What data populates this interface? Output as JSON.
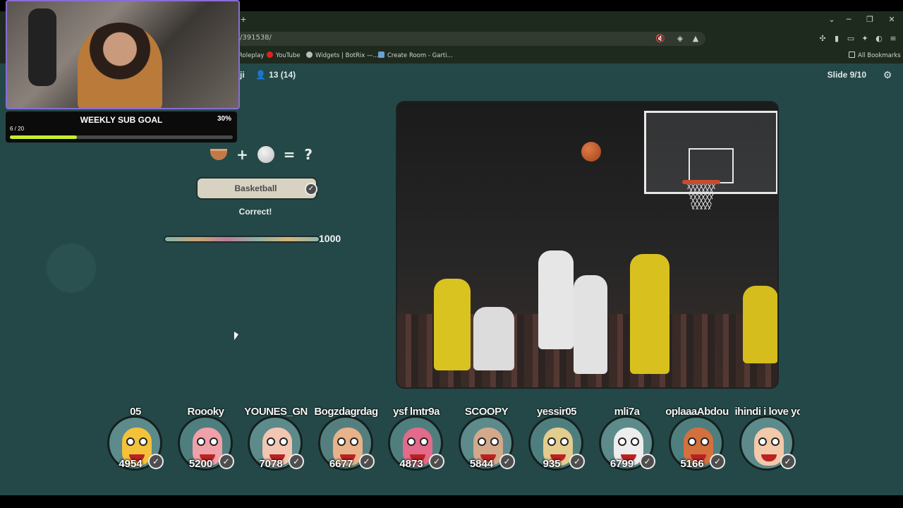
{
  "browser": {
    "url": "/391538/",
    "bookmarks": [
      {
        "label": "Roleplay",
        "color": "#9b4dd6"
      },
      {
        "label": "YouTube",
        "color": "#e02020"
      },
      {
        "label": "Widgets | BotRix —...",
        "color": "#bcbcbc"
      },
      {
        "label": "Create Room - Garti...",
        "color": "#6aa0d6"
      }
    ],
    "all_bookmarks": "All Bookmarks"
  },
  "game": {
    "title_fragment": "ji",
    "players": "13 (14)",
    "slide": "Slide 9/10",
    "puzzle": {
      "plus": "+",
      "equals": "=",
      "question": "?"
    },
    "answer": "Basketball",
    "result": "Correct!",
    "score": "1000",
    "score_progress": 1.0
  },
  "overlay": {
    "subgoal_title": "WEEKLY SUB GOAL",
    "subgoal_percent": "30%",
    "subgoal_count": "6 / 20",
    "subgoal_progress": 0.3
  },
  "leaderboard": [
    {
      "name": "05",
      "score": "4954",
      "face": "#f3c23a",
      "bg": "#5d8a8a"
    },
    {
      "name": "Roooky",
      "score": "5200",
      "face": "#f0a0a8",
      "bg": "#4e7f7e"
    },
    {
      "name": "YOUNES_GN",
      "score": "7078",
      "face": "#f2c6b2",
      "bg": "#5d8a8a"
    },
    {
      "name": "Bogzdagrdag",
      "score": "6677",
      "face": "#e8b28a",
      "bg": "#557f7f"
    },
    {
      "name": "ysf lmtr9a",
      "score": "4873",
      "face": "#e26a8a",
      "bg": "#4e7f7e"
    },
    {
      "name": "SCOOPY",
      "score": "5844",
      "face": "#d2a98a",
      "bg": "#5d8a8a"
    },
    {
      "name": "yessir05",
      "score": "935",
      "face": "#e2cc8e",
      "bg": "#4e7f7e"
    },
    {
      "name": "mli7a",
      "score": "6799",
      "face": "#ededed",
      "bg": "#5d8a8a"
    },
    {
      "name": "oplaaaAbdou",
      "score": "5166",
      "face": "#d4703e",
      "bg": "#4e7f7e"
    },
    {
      "name": "ihindi i love you noc",
      "score": "",
      "face": "#f2c9a9",
      "bg": "#5d8a8a"
    }
  ]
}
